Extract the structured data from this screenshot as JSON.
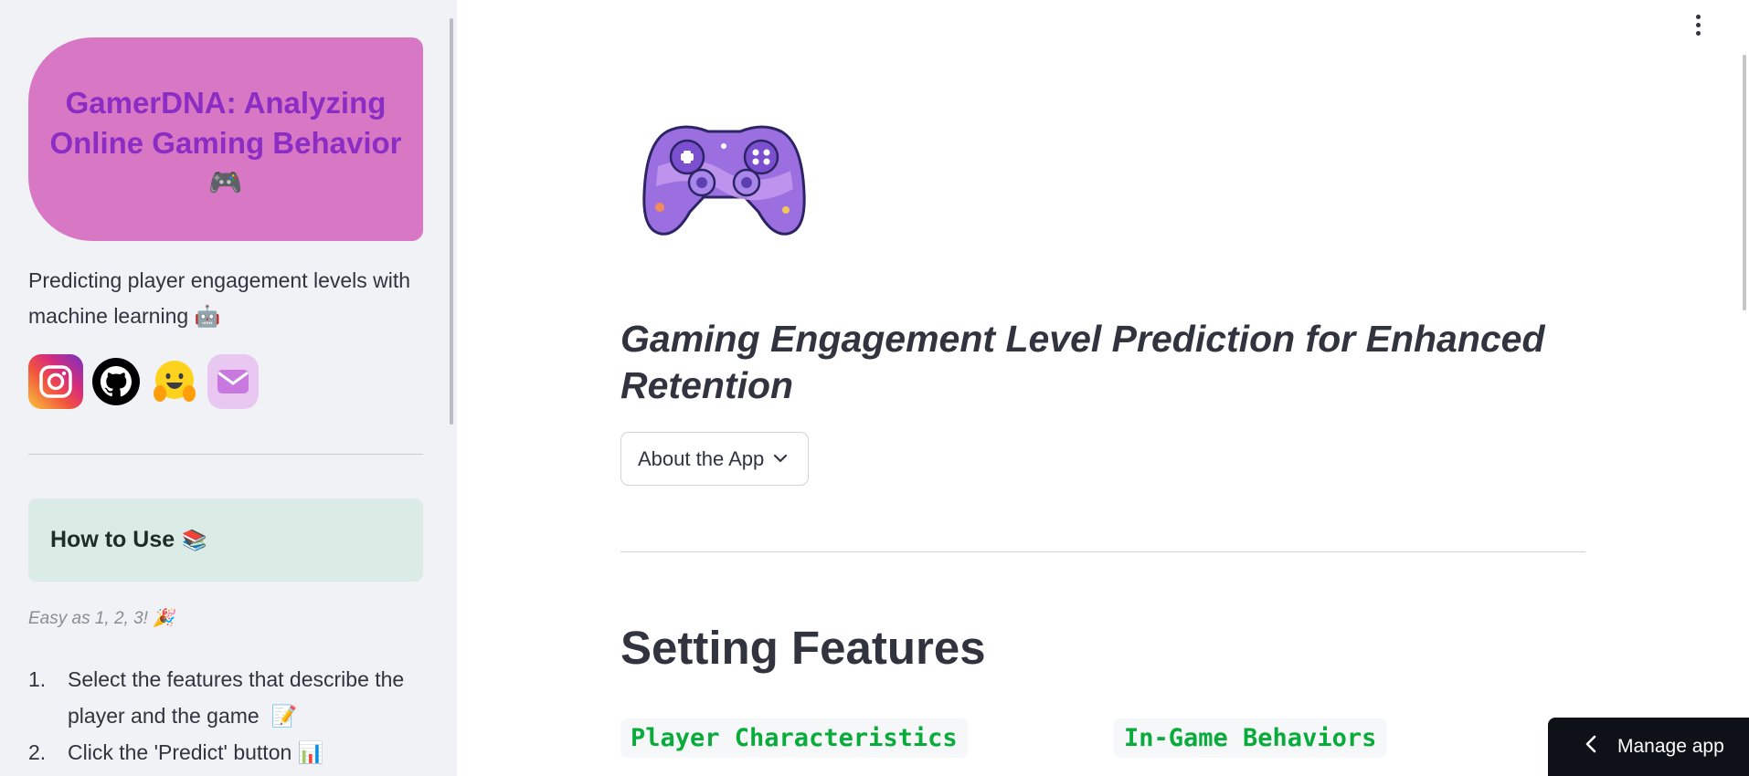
{
  "sidebar": {
    "hero_title": "GamerDNA: Analyzing Online Gaming Behavior",
    "hero_emoji": "🎮",
    "tagline": "Predicting player engagement levels with machine learning",
    "tagline_emoji": "🤖",
    "social_icons": [
      "instagram-icon",
      "github-icon",
      "huggingface-icon",
      "mail-icon"
    ],
    "howto_title": "How to Use",
    "howto_emoji": "📚",
    "easy_text": "Easy as 1, 2, 3!",
    "easy_emoji": "🎉",
    "steps": [
      {
        "num": "1.",
        "text": "Select the features that describe the player and the game",
        "emoji": "📝"
      },
      {
        "num": "2.",
        "text": "Click the 'Predict' button",
        "emoji": "📊"
      }
    ]
  },
  "main": {
    "title": "Gaming Engagement Level Prediction for Enhanced Retention",
    "about_label": "About the App",
    "section_heading": "Setting Features",
    "col1_label": "Player Characteristics",
    "col2_label": "In-Game Behaviors"
  },
  "footer": {
    "manage_label": "Manage app"
  },
  "colors": {
    "hero_bg": "#d878c4",
    "hero_text": "#8b2cc4",
    "howto_bg": "#dbebe5",
    "code_text": "#09ab3b",
    "manage_bg": "#0e1117"
  }
}
